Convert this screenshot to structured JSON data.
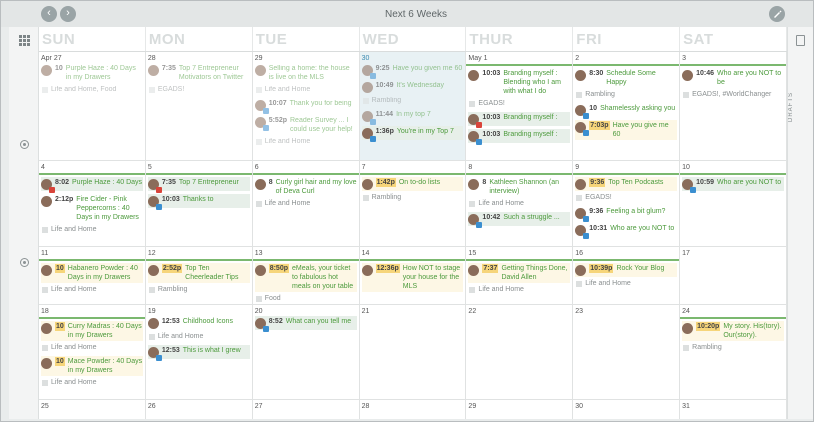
{
  "header": {
    "title": "Next 6 Weeks"
  },
  "icons": {
    "prev": "chevron-left-icon",
    "next": "chevron-right-icon",
    "edit": "pencil-icon",
    "grid": "grid-icon",
    "trash": "trash-icon"
  },
  "sidebar": {
    "drafts": "DRAFTS"
  },
  "days": [
    "SUN",
    "MON",
    "TUE",
    "WED",
    "THUR",
    "FRI",
    "SAT"
  ],
  "colors": {
    "accent": "#7bb86f",
    "text_green": "#4c9a3c",
    "highlight": "#e8f1f4",
    "time_badge": "#f6d57a"
  },
  "weeks": [
    [
      {
        "date": "Apr 27",
        "bar": false,
        "items": [
          {
            "k": "p",
            "time": "10",
            "text": "Purple Haze : 40 Days in my Drawers",
            "f": true
          },
          {
            "k": "l",
            "text": "Life and Home, Food",
            "f": true
          }
        ]
      },
      {
        "date": "28",
        "bar": false,
        "items": [
          {
            "k": "p",
            "time": "7:35",
            "text": "Top 7 Entrepreneur Motivators on Twitter",
            "f": true
          },
          {
            "k": "l",
            "text": "EGADS!",
            "f": true
          }
        ]
      },
      {
        "date": "29",
        "bar": false,
        "items": [
          {
            "k": "p",
            "time": "",
            "text": "Selling a home: the house is live on the MLS",
            "f": true
          },
          {
            "k": "l",
            "text": "Life and Home",
            "f": true
          },
          {
            "k": "p",
            "time": "10:07",
            "text": "Thank you for being",
            "f": true,
            "badge": "tw"
          },
          {
            "k": "p",
            "time": "5:52p",
            "text": "Reader Survey ... I could use your help!",
            "f": true,
            "badge": "tw"
          },
          {
            "k": "l",
            "text": "Life and Home",
            "f": true
          }
        ]
      },
      {
        "date": "30",
        "bar": false,
        "hl": true,
        "items": [
          {
            "k": "p",
            "time": "9:25",
            "text": "Have you given me 60",
            "f": true,
            "badge": "tw"
          },
          {
            "k": "p",
            "time": "10:49",
            "text": "It's Wednesday",
            "f": true
          },
          {
            "k": "l",
            "text": "Rambling",
            "f": true
          },
          {
            "k": "p",
            "time": "11:44",
            "text": "In my top 7",
            "f": true,
            "badge": "tw"
          },
          {
            "k": "p",
            "time": "1:36p",
            "text": "You're in my Top 7",
            "badge": "tw",
            "bg": "g"
          }
        ]
      },
      {
        "date": "May 1",
        "bar": true,
        "items": [
          {
            "k": "p",
            "time": "10:03",
            "text": "Branding myself : Blending who I am with what I do"
          },
          {
            "k": "l",
            "text": "EGADS!"
          },
          {
            "k": "p",
            "time": "10:03",
            "text": "Branding myself :",
            "badge": "fb",
            "bg": "g"
          },
          {
            "k": "p",
            "time": "10:03",
            "text": "Branding myself :",
            "badge": "tw",
            "bg": "g"
          }
        ]
      },
      {
        "date": "2",
        "bar": true,
        "items": [
          {
            "k": "p",
            "time": "8:30",
            "text": "Schedule Some Happy"
          },
          {
            "k": "l",
            "text": "Rambling"
          },
          {
            "k": "p",
            "time": "10",
            "text": "Shamelessly asking you",
            "badge": "tw"
          },
          {
            "k": "p",
            "time": "7:03p",
            "text": "Have you give me 60",
            "badge": "tw",
            "bg": "y"
          }
        ]
      },
      {
        "date": "3",
        "bar": true,
        "items": [
          {
            "k": "p",
            "time": "10:46",
            "text": "Who are you NOT to be"
          },
          {
            "k": "l",
            "text": "EGADS!, #WorldChanger"
          }
        ]
      }
    ],
    [
      {
        "date": "4",
        "bar": true,
        "items": [
          {
            "k": "p",
            "time": "8:02",
            "text": "Purple Haze : 40 Days",
            "badge": "fb",
            "bg": "g"
          },
          {
            "k": "p",
            "time": "2:12p",
            "text": "Fire Cider - Pink Peppercorns : 40 Days in my Drawers"
          },
          {
            "k": "l",
            "text": "Life and Home"
          }
        ]
      },
      {
        "date": "5",
        "bar": true,
        "items": [
          {
            "k": "p",
            "time": "7:35",
            "text": "Top 7 Entrepreneur",
            "badge": "fb",
            "bg": "g"
          },
          {
            "k": "p",
            "time": "10:03",
            "text": "Thanks to",
            "badge": "tw",
            "bg": "g"
          }
        ]
      },
      {
        "date": "6",
        "bar": true,
        "items": [
          {
            "k": "p",
            "time": "8",
            "text": "Curly girl hair and my love of Deva Curl"
          },
          {
            "k": "l",
            "text": "Life and Home"
          }
        ]
      },
      {
        "date": "7",
        "bar": true,
        "items": [
          {
            "k": "p",
            "time": "1:42p",
            "text": "On to-do lists",
            "bg": "y"
          },
          {
            "k": "l",
            "text": "Rambling"
          }
        ]
      },
      {
        "date": "8",
        "bar": true,
        "items": [
          {
            "k": "p",
            "time": "8",
            "text": "Kathleen Shannon (an interview)"
          },
          {
            "k": "l",
            "text": "Life and Home"
          },
          {
            "k": "p",
            "time": "10:42",
            "text": "Such a struggle ...",
            "badge": "tw",
            "bg": "g"
          }
        ]
      },
      {
        "date": "9",
        "bar": true,
        "items": [
          {
            "k": "p",
            "time": "9:36",
            "text": "Top Ten Podcasts",
            "bg": "y"
          },
          {
            "k": "l",
            "text": "EGADS!"
          },
          {
            "k": "p",
            "time": "9:36",
            "text": "Feeling a bit glum?",
            "badge": "tw"
          },
          {
            "k": "p",
            "time": "10:31",
            "text": "Who are you NOT to",
            "badge": "tw"
          }
        ]
      },
      {
        "date": "10",
        "bar": true,
        "items": [
          {
            "k": "p",
            "time": "10:59",
            "text": "Who are you NOT to",
            "badge": "tw",
            "bg": "g"
          }
        ]
      }
    ],
    [
      {
        "date": "11",
        "bar": true,
        "items": [
          {
            "k": "p",
            "time": "10",
            "text": "Habanero Powder : 40 Days in my Drawers",
            "bg": "y"
          },
          {
            "k": "l",
            "text": "Life and Home"
          }
        ]
      },
      {
        "date": "12",
        "bar": true,
        "items": [
          {
            "k": "p",
            "time": "2:52p",
            "text": "Top Ten Cheerleader Tips",
            "bg": "y"
          },
          {
            "k": "l",
            "text": "Rambling"
          }
        ]
      },
      {
        "date": "13",
        "bar": true,
        "items": [
          {
            "k": "p",
            "time": "8:50p",
            "text": "eMeals, your ticket to fabulous hot meals on your table",
            "bg": "y"
          },
          {
            "k": "l",
            "text": "Food"
          }
        ]
      },
      {
        "date": "14",
        "bar": true,
        "items": [
          {
            "k": "p",
            "time": "12:36p",
            "text": "How NOT to stage your house for the MLS",
            "bg": "y"
          }
        ]
      },
      {
        "date": "15",
        "bar": true,
        "items": [
          {
            "k": "p",
            "time": "7:37",
            "text": "Getting Things Done, David Allen",
            "bg": "y"
          },
          {
            "k": "l",
            "text": "Life and Home"
          }
        ]
      },
      {
        "date": "16",
        "bar": true,
        "items": [
          {
            "k": "p",
            "time": "10:39p",
            "text": "Rock Your Blog",
            "bg": "y"
          },
          {
            "k": "l",
            "text": "Life and Home"
          }
        ]
      },
      {
        "date": "17",
        "bar": false,
        "items": []
      }
    ],
    [
      {
        "date": "18",
        "bar": true,
        "items": [
          {
            "k": "p",
            "time": "10",
            "text": "Curry Madras : 40 Days in my Drawers",
            "bg": "y"
          },
          {
            "k": "l",
            "text": "Life and Home"
          },
          {
            "k": "p",
            "time": "10",
            "text": "Mace Powder : 40 Days in my Drawers",
            "bg": "y"
          },
          {
            "k": "l",
            "text": "Life and Home"
          }
        ]
      },
      {
        "date": "19",
        "bar": false,
        "items": [
          {
            "k": "p",
            "time": "12:53",
            "text": "Childhood Icons"
          },
          {
            "k": "l",
            "text": "Life and Home"
          },
          {
            "k": "p",
            "time": "12:53",
            "text": "This is what I grew",
            "badge": "tw",
            "bg": "g"
          }
        ]
      },
      {
        "date": "20",
        "bar": false,
        "items": [
          {
            "k": "p",
            "time": "8:52",
            "text": "What can you tell me",
            "badge": "tw",
            "bg": "g"
          }
        ]
      },
      {
        "date": "21",
        "bar": false,
        "items": []
      },
      {
        "date": "22",
        "bar": false,
        "items": []
      },
      {
        "date": "23",
        "bar": false,
        "items": []
      },
      {
        "date": "24",
        "bar": true,
        "items": [
          {
            "k": "p",
            "time": "10:20p",
            "text": "My story. His(tory). Our(story).",
            "bg": "y"
          },
          {
            "k": "l",
            "text": "Rambling"
          }
        ]
      }
    ],
    [
      {
        "date": "25",
        "bar": false,
        "items": []
      },
      {
        "date": "26",
        "bar": false,
        "items": []
      },
      {
        "date": "27",
        "bar": false,
        "items": []
      },
      {
        "date": "28",
        "bar": false,
        "items": []
      },
      {
        "date": "29",
        "bar": false,
        "items": []
      },
      {
        "date": "30",
        "bar": false,
        "items": []
      },
      {
        "date": "31",
        "bar": false,
        "items": []
      }
    ]
  ]
}
